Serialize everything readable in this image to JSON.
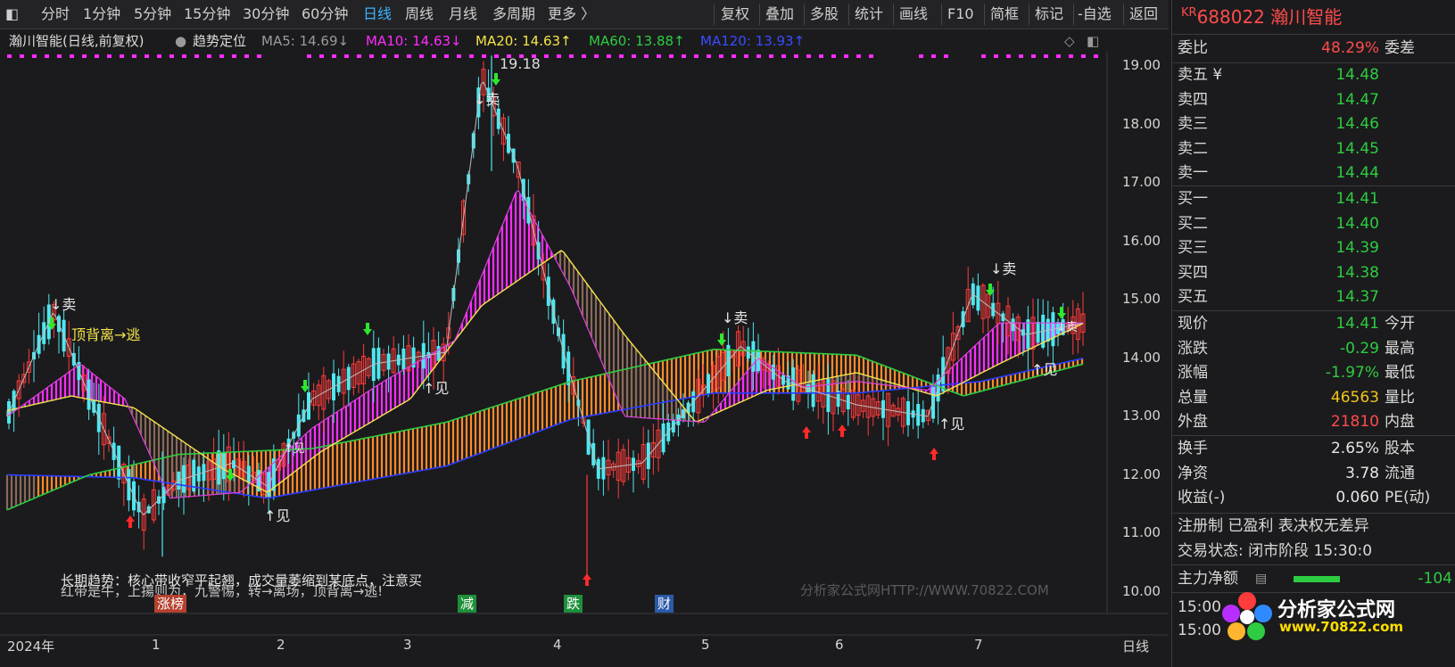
{
  "toolbar": {
    "items": [
      "分时",
      "1分钟",
      "5分钟",
      "15分钟",
      "30分钟",
      "60分钟",
      "日线",
      "周线",
      "月线",
      "多周期",
      "更多 〉"
    ],
    "right_items": [
      "复权",
      "叠加",
      "多股",
      "统计",
      "画线",
      "F10",
      "简框",
      "标记",
      "-自选",
      "返回"
    ]
  },
  "info": {
    "stock": "瀚川智能(日线,前复权)",
    "indicator": "趋势定位",
    "ma5": "MA5: 14.69↓",
    "ma10": "MA10: 14.63↓",
    "ma20": "MA20: 14.63↑",
    "ma60": "MA60: 13.88↑",
    "ma120": "MA120: 13.93↑"
  },
  "colors": {
    "ma5": "#9a9a9a",
    "ma10": "#ff2bff",
    "ma20": "#f5e44a",
    "ma60": "#2ecc40",
    "ma120": "#2a3cff",
    "up": "#ff3b3b",
    "down": "#4ee8f0",
    "orange": "#ff8a2a"
  },
  "chart_data": {
    "type": "candlestick",
    "y_ticks": [
      "19.00",
      "18.00",
      "17.00",
      "16.00",
      "15.00",
      "14.00",
      "13.00",
      "12.00",
      "11.00",
      "10.00"
    ],
    "x_labels": [
      "2024年",
      "1",
      "2",
      "3",
      "4",
      "5",
      "6",
      "7"
    ],
    "x_axis_right": "日线",
    "high_label": "19.18",
    "annotations": [
      "↓卖",
      "顶背离→逃",
      "↓卖",
      "↑见",
      "↑见",
      "↓卖",
      "↑见",
      "↑见",
      "↓卖",
      "↓卖",
      "↑见"
    ],
    "badges": [
      {
        "text": "涨榜",
        "color": "#b5412e"
      },
      {
        "text": "减",
        "color": "#1e8f3a"
      },
      {
        "text": "跌",
        "color": "#1e8f3a"
      },
      {
        "text": "财",
        "color": "#2a5aa8"
      }
    ],
    "legend_text_1": "长期趋势：核心带收窄平起翘，成交量萎缩到某底点，注意买",
    "legend_text_2": "红带是牛，上揚则为，九警惕，转→离场，顶背离→逃!",
    "watermark": "分析家公式网HTTP://WWW.70822.COM"
  },
  "panel": {
    "code": "688022",
    "name": "瀚川智能",
    "kr": "KR",
    "weibi": {
      "label": "委比",
      "value": "48.29%",
      "right": "委差"
    },
    "asks": [
      {
        "label": "卖五 ¥",
        "price": "14.48"
      },
      {
        "label": "卖四",
        "price": "14.47"
      },
      {
        "label": "卖三",
        "price": "14.46"
      },
      {
        "label": "卖二",
        "price": "14.45"
      },
      {
        "label": "卖一",
        "price": "14.44"
      }
    ],
    "bids": [
      {
        "label": "买一",
        "price": "14.41"
      },
      {
        "label": "买二",
        "price": "14.40"
      },
      {
        "label": "买三",
        "price": "14.39"
      },
      {
        "label": "买四",
        "price": "14.38"
      },
      {
        "label": "买五",
        "price": "14.37"
      }
    ],
    "stats": [
      {
        "label": "现价",
        "value": "14.41",
        "right": "今开",
        "cls": "green"
      },
      {
        "label": "涨跌",
        "value": "-0.29",
        "right": "最高",
        "cls": "green"
      },
      {
        "label": "涨幅",
        "value": "-1.97%",
        "right": "最低",
        "cls": "green"
      },
      {
        "label": "总量",
        "value": "46563",
        "right": "量比",
        "cls": "yellow"
      },
      {
        "label": "外盘",
        "value": "21810",
        "right": "内盘",
        "cls": "red"
      }
    ],
    "stats2": [
      {
        "label": "换手",
        "value": "2.65%",
        "right": "股本"
      },
      {
        "label": "净资",
        "value": "3.78",
        "right": "流通"
      },
      {
        "label": "收益(-)",
        "value": "0.060",
        "right": "PE(动)"
      }
    ],
    "tags": "注册制 已盈利 表决权无差异",
    "trade_status": "交易状态: 闭市阶段 15:30:0",
    "main_force": {
      "label": "主力净额",
      "value": "-104"
    },
    "times": [
      "15:00",
      "15:00"
    ],
    "logo_text": "分析家公式网",
    "logo_url": "www.70822.com"
  }
}
